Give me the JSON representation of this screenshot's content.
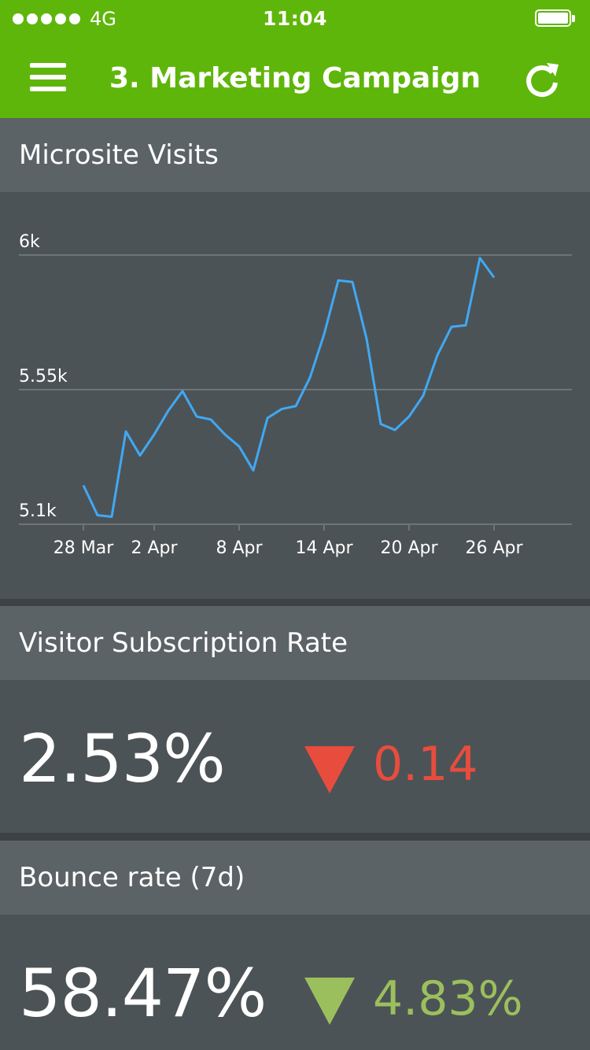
{
  "status_bar": {
    "carrier": "4G",
    "time": "11:04"
  },
  "header": {
    "title": "3. Marketing Campaign"
  },
  "microsite_visits": {
    "title": "Microsite Visits",
    "chart_data": {
      "type": "line",
      "title": "",
      "xlabel": "",
      "ylabel": "",
      "y_tick_labels": [
        "6k",
        "5.55k",
        "5.1k"
      ],
      "y_ticks": [
        6000,
        5550,
        5100
      ],
      "ylim": [
        5100,
        6000
      ],
      "x_tick_labels": [
        "28 Mar",
        "2 Apr",
        "8 Apr",
        "14 Apr",
        "20 Apr",
        "26 Apr"
      ],
      "x_ticks": [
        "2015-03-28",
        "2015-04-02",
        "2015-04-08",
        "2015-04-14",
        "2015-04-20",
        "2015-04-26"
      ],
      "xlim": [
        "2015-03-28",
        "2015-04-26"
      ],
      "grid": true,
      "line_color": "#3fa9f5",
      "series": [
        {
          "name": "",
          "x": [
            "2015-03-28",
            "2015-03-29",
            "2015-03-30",
            "2015-03-31",
            "2015-04-01",
            "2015-04-02",
            "2015-04-03",
            "2015-04-04",
            "2015-04-05",
            "2015-04-06",
            "2015-04-07",
            "2015-04-08",
            "2015-04-09",
            "2015-04-10",
            "2015-04-11",
            "2015-04-12",
            "2015-04-13",
            "2015-04-14",
            "2015-04-15",
            "2015-04-16",
            "2015-04-17",
            "2015-04-18",
            "2015-04-19",
            "2015-04-20",
            "2015-04-21",
            "2015-04-22",
            "2015-04-23",
            "2015-04-24",
            "2015-04-25",
            "2015-04-26"
          ],
          "values": [
            5230,
            5130,
            5125,
            5410,
            5330,
            5400,
            5480,
            5545,
            5460,
            5450,
            5400,
            5360,
            5280,
            5455,
            5485,
            5495,
            5590,
            5735,
            5915,
            5910,
            5720,
            5435,
            5415,
            5460,
            5530,
            5665,
            5760,
            5765,
            5990,
            5925
          ]
        }
      ]
    }
  },
  "subscription_rate": {
    "title": "Visitor Subscription Rate",
    "value": "2.53%",
    "delta": "0.14",
    "delta_direction": "down",
    "delta_color": "#e84c3d"
  },
  "bounce_rate": {
    "title": "Bounce rate (7d)",
    "value": "58.47%",
    "delta": "4.83%",
    "delta_direction": "down",
    "delta_color": "#9cbf5d"
  },
  "colors": {
    "accent": "#5fb60a",
    "card_header": "#5c6366",
    "card_body": "#4c5356",
    "divider": "#3d4245"
  },
  "icons": {
    "menu": "hamburger-icon",
    "refresh": "refresh-icon",
    "battery": "battery-icon",
    "signal": "signal-dots-icon"
  }
}
